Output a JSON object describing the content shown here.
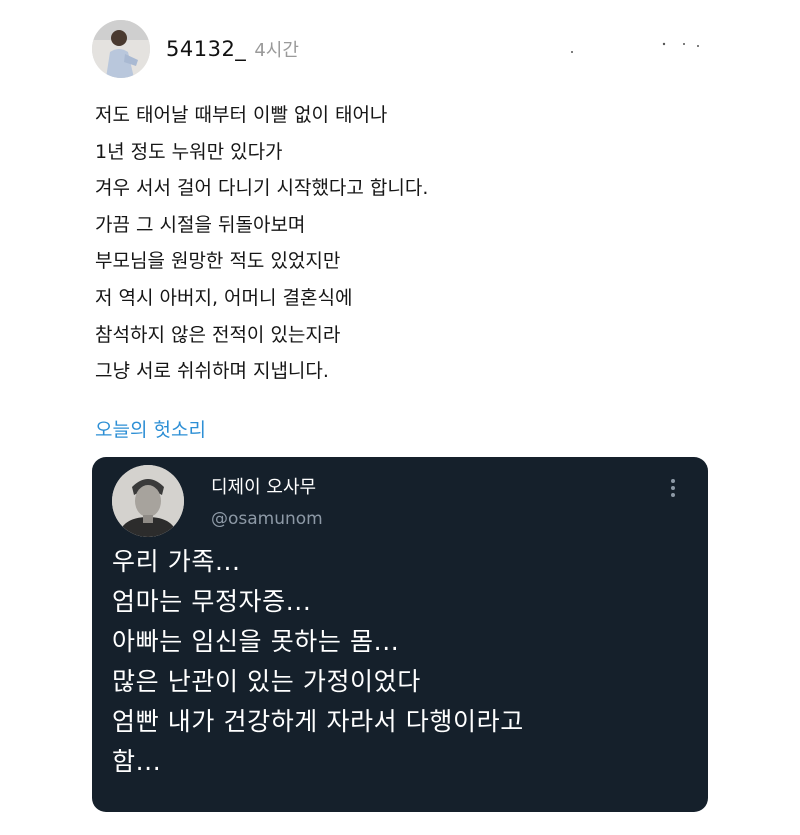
{
  "post": {
    "username": "54132_",
    "time_ago": "4시간",
    "lines": [
      "저도 태어날 때부터 이빨 없이 태어나",
      "1년 정도 누워만 있다가",
      "겨우 서서 걸어 다니기 시작했다고 합니다.",
      "가끔 그 시절을 뒤돌아보며",
      "부모님을 원망한 적도 있었지만",
      "저 역시 아버지, 어머니 결혼식에",
      "참석하지 않은 전적이 있는지라",
      "그냥 서로 쉬쉬하며 지냅니다."
    ],
    "hashtag": "오늘의 헛소리",
    "link_color": "#2d8fd5"
  },
  "quoted_tweet": {
    "name": "디제이 오사무",
    "handle": "@osamunom",
    "more_icon": "vertical-dots-icon",
    "lines": [
      "우리 가족...",
      "엄마는 무정자증...",
      "아빠는 임신을 못하는 몸...",
      "많은 난관이 있는 가정이었다",
      "엄빤 내가 건강하게 자라서 다행이라고",
      "함..."
    ],
    "background": "#15202b"
  }
}
